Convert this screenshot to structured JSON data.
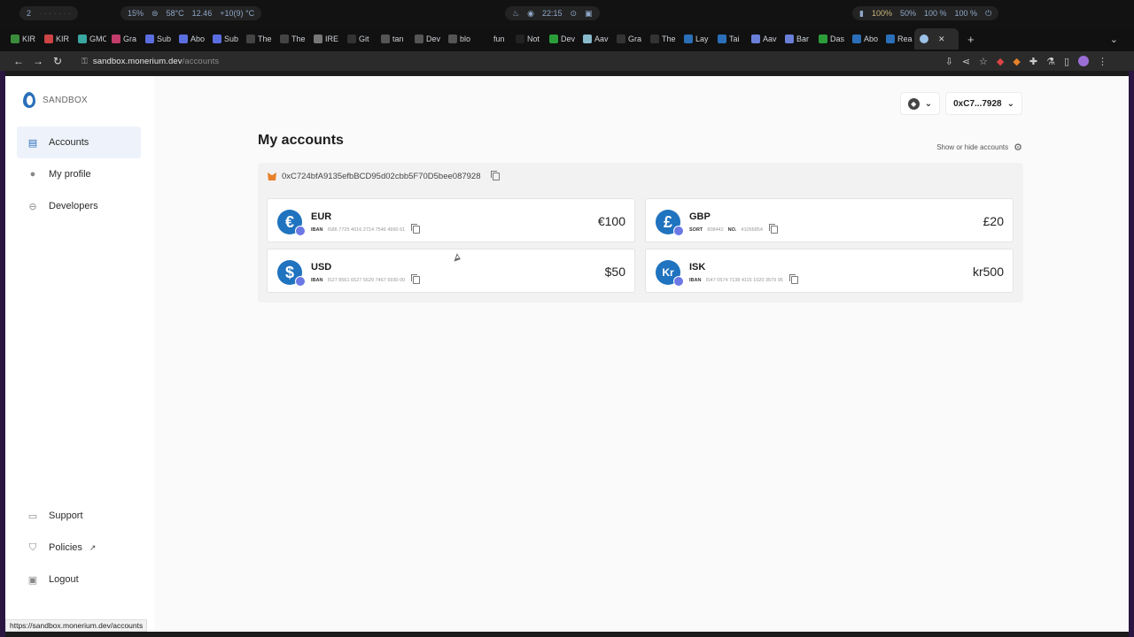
{
  "system": {
    "workspaces": "2",
    "cpu": "15%",
    "temp": "58°C",
    "speed": "12.46",
    "weather": "+10(9) °C",
    "clock": "22:15",
    "signal": "100%",
    "brightness": "50%",
    "volume": "100 %",
    "mic": "100 %"
  },
  "browser": {
    "tabs": [
      {
        "label": "KIR",
        "color": "#3b8c3b"
      },
      {
        "label": "KIR",
        "color": "#cc4444"
      },
      {
        "label": "GMO",
        "color": "#3aa6a0"
      },
      {
        "label": "Gra",
        "color": "#c33c6b"
      },
      {
        "label": "Sub",
        "color": "#5a6ee0"
      },
      {
        "label": "Abo",
        "color": "#5a6ee0"
      },
      {
        "label": "Sub",
        "color": "#5a6ee0"
      },
      {
        "label": "The",
        "color": "#444"
      },
      {
        "label": "The",
        "color": "#444"
      },
      {
        "label": "IRE",
        "color": "#777"
      },
      {
        "label": "Git",
        "color": "#333"
      },
      {
        "label": "tan",
        "color": "#555"
      },
      {
        "label": "Dev",
        "color": "#555"
      },
      {
        "label": "blo",
        "color": "#555"
      },
      {
        "label": "fun",
        "color": "#111"
      },
      {
        "label": "Not",
        "color": "#222"
      },
      {
        "label": "Dev",
        "color": "#2a9d3a"
      },
      {
        "label": "Aav",
        "color": "#8bc"
      },
      {
        "label": "Gra",
        "color": "#333"
      },
      {
        "label": "The",
        "color": "#333"
      },
      {
        "label": "Lay",
        "color": "#2a6fb8"
      },
      {
        "label": "Tai",
        "color": "#2a6fb8"
      },
      {
        "label": "Aav",
        "color": "#6a7fd8"
      },
      {
        "label": "Bar",
        "color": "#6a7fd8"
      },
      {
        "label": "Das",
        "color": "#2a9d3a"
      },
      {
        "label": "Abo",
        "color": "#2a6fb8"
      },
      {
        "label": "Rea",
        "color": "#2a6fb8"
      }
    ],
    "active_tab_icon": "monerium-icon",
    "url_host": "sandbox.monerium.dev",
    "url_path": "/accounts",
    "status_url": "https://sandbox.monerium.dev/accounts"
  },
  "sidebar": {
    "brand": "SANDBOX",
    "items": [
      {
        "label": "Accounts",
        "icon": "accounts-icon"
      },
      {
        "label": "My profile",
        "icon": "user-icon"
      },
      {
        "label": "Developers",
        "icon": "toggle-icon"
      }
    ],
    "bottom": [
      {
        "label": "Support",
        "icon": "chat-icon"
      },
      {
        "label": "Policies",
        "icon": "shield-icon"
      },
      {
        "label": "Logout",
        "icon": "lock-icon"
      }
    ]
  },
  "header": {
    "network_icon": "ethereum-icon",
    "wallet_short": "0xC7...7928"
  },
  "main": {
    "title": "My accounts",
    "show_hide": "Show or hide accounts",
    "wallet_address": "0xC724bfA9135efbBCD95d02cbb5F70D5bee087928",
    "accounts": [
      {
        "code": "EUR",
        "symbol": "€",
        "id_label": "IBAN",
        "id_value": "IS86 7725 4016 2714 7546 4990 61",
        "balance": "€100"
      },
      {
        "code": "GBP",
        "symbol": "£",
        "id_label": "SORT",
        "id_value": "808442",
        "id_label2": "NO.",
        "id_value2": "41056854",
        "balance": "£20"
      },
      {
        "code": "USD",
        "symbol": "$",
        "id_label": "IBAN",
        "id_value": "IS27 8561 6527 5629 7467 6930 00",
        "balance": "$50"
      },
      {
        "code": "ISK",
        "symbol": "Kr",
        "id_label": "IBAN",
        "id_value": "IS47 0574 7138 4115 1020 3579 95",
        "balance": "kr500"
      }
    ]
  }
}
